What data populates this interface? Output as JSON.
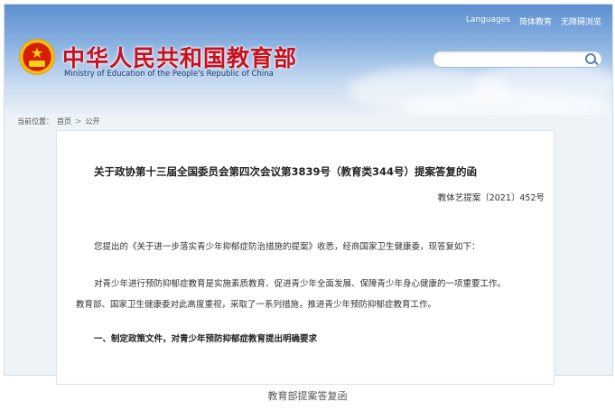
{
  "header": {
    "links": [
      "Languages",
      "简体教育",
      "无障碍浏览"
    ],
    "site_title": "中华人民共和国教育部",
    "site_subtitle": "Ministry of Education of the People's Republic of China"
  },
  "breadcrumb": {
    "prefix": "当前位置：",
    "items": [
      "首页",
      "公开"
    ],
    "separator": ">"
  },
  "document": {
    "title": "关于政协第十三届全国委员会第四次会议第3839号（教育类344号）提案答复的函",
    "number": "教体艺提案〔2021〕452号",
    "paragraph1": "您提出的《关于进一步落实青少年抑郁症防治措施的提案》收悉，经商国家卫生健康委，现答复如下：",
    "paragraph2_line1": "对青少年进行预防抑郁症教育是实施素质教育、促进青少年全面发展、保障青少年身心健康的一项重要工作。",
    "paragraph2_line2": "教育部、国家卫生健康委对此高度重视，采取了一系列措施，推进青少年预防抑郁症教育工作。",
    "section1": "一、制定政策文件，对青少年预防抑郁症教育提出明确要求"
  },
  "caption": "教育部提案答复函",
  "colors": {
    "header_blue": "#5e8fd0",
    "title_red": "#c8101f"
  },
  "icons": {
    "emblem": "national-emblem-icon",
    "search": "search-icon"
  }
}
